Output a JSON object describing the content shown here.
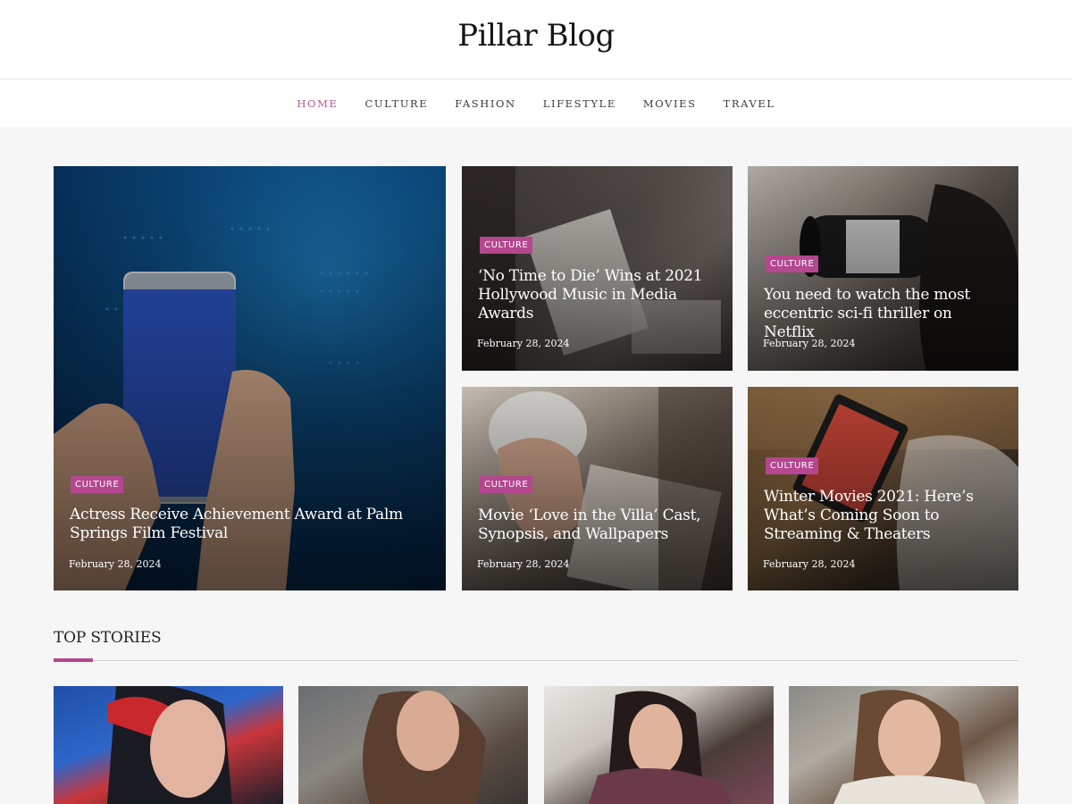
{
  "site": {
    "title": "Pillar Blog"
  },
  "nav": {
    "items": [
      {
        "label": "HOME",
        "active": true
      },
      {
        "label": "CULTURE",
        "active": false
      },
      {
        "label": "FASHION",
        "active": false
      },
      {
        "label": "LIFESTYLE",
        "active": false
      },
      {
        "label": "MOVIES",
        "active": false
      },
      {
        "label": "TRAVEL",
        "active": false
      }
    ]
  },
  "featured": {
    "main": {
      "category": "CULTURE",
      "title": "Actress Receive Achievement Award at Palm Springs Film Festival",
      "date": "February 28, 2024"
    },
    "grid": [
      {
        "category": "CULTURE",
        "title": "‘No Time to Die’ Wins at 2021 Hollywood Music in Media Awards",
        "date": "February 28, 2024"
      },
      {
        "category": "CULTURE",
        "title": "You need to watch the most eccentric sci-fi thriller on Netflix",
        "date": "February 28, 2024"
      },
      {
        "category": "CULTURE",
        "title": "Movie ‘Love in the Villa’ Cast, Synopsis, and Wallpapers",
        "date": "February 28, 2024"
      },
      {
        "category": "CULTURE",
        "title": "Winter Movies 2021: Here’s What’s Coming Soon to Streaming & Theaters",
        "date": "February 28, 2024"
      }
    ]
  },
  "top_stories": {
    "heading": "TOP STORIES"
  },
  "colors": {
    "accent": "#b5478f",
    "nav_active": "#b5579a"
  }
}
